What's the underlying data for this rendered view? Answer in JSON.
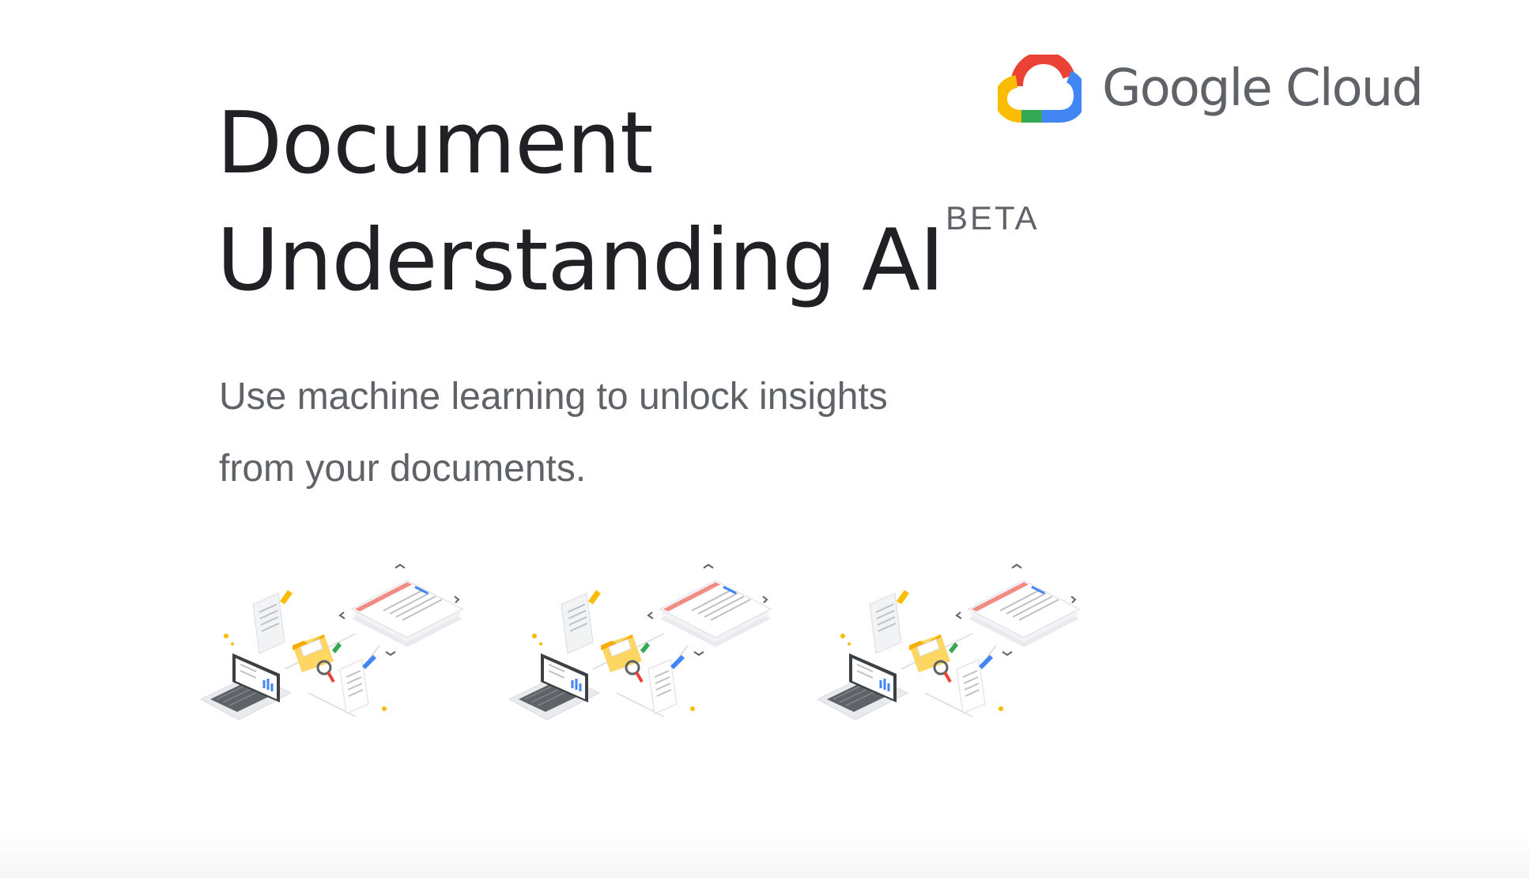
{
  "brand": {
    "logo_name": "google-cloud-logo",
    "name": "Google Cloud",
    "colors": {
      "red": "#ea4335",
      "yellow": "#fbbc04",
      "green": "#34a853",
      "blue": "#4285f4",
      "text_gray": "#5f6368"
    }
  },
  "hero": {
    "title_line1": "Document",
    "title_line2": "Understanding AI",
    "badge": "BETA",
    "subtitle_line1": "Use machine learning to unlock insights",
    "subtitle_line2": "from your documents."
  },
  "illustrations": [
    {
      "icon": "document-processing-illustration"
    },
    {
      "icon": "document-processing-illustration"
    },
    {
      "icon": "document-processing-illustration"
    }
  ]
}
